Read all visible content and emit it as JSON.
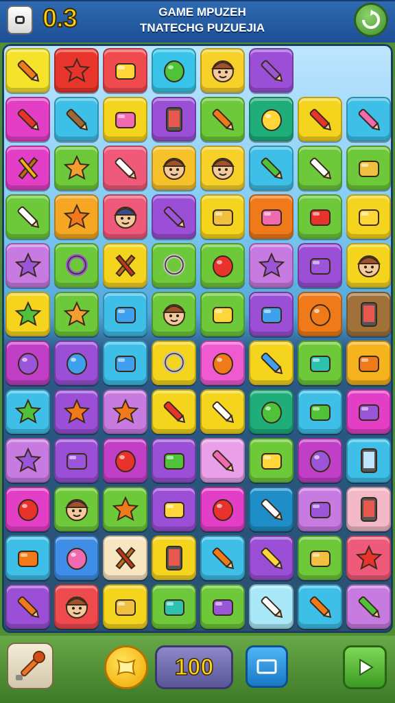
{
  "header": {
    "score": "0.3",
    "title_line1": "GAME MPUZEH",
    "title_line2": "TNATECHG PUZUEJIA"
  },
  "footer": {
    "moves_value": "100"
  },
  "board": {
    "rows": [
      [
        {
          "icon": "orange-crayon",
          "bg": "#f5e22a"
        },
        {
          "icon": "red-candy",
          "bg": "#e8362c"
        },
        {
          "icon": "yellow-sandwich",
          "bg": "#ef4a4e"
        },
        {
          "icon": "green-egg",
          "bg": "#38c4e8"
        },
        {
          "icon": "character-face",
          "bg": "#f7d12a"
        },
        {
          "icon": "purple-pencil",
          "bg": "#9a4fd6"
        },
        {
          "icon": "none",
          "bg": ""
        },
        {
          "icon": "none",
          "bg": ""
        }
      ],
      [
        {
          "icon": "red-marker",
          "bg": "#e23fc6"
        },
        {
          "icon": "brown-spoon",
          "bg": "#3ebfe8"
        },
        {
          "icon": "pink-popsicle",
          "bg": "#f5d41e"
        },
        {
          "icon": "phone",
          "bg": "#9a4fd6"
        },
        {
          "icon": "orange-marker",
          "bg": "#6dc83a"
        },
        {
          "icon": "yellow-lemon",
          "bg": "#1fae7a"
        },
        {
          "icon": "red-marker",
          "bg": "#f5d41e"
        },
        {
          "icon": "pink-marker",
          "bg": "#3ebfe8"
        }
      ],
      [
        {
          "icon": "hammer",
          "bg": "#e23fc6"
        },
        {
          "icon": "cookie",
          "bg": "#6dc83a"
        },
        {
          "icon": "marker",
          "bg": "#ef5a7a"
        },
        {
          "icon": "character-face",
          "bg": "#f7c12a"
        },
        {
          "icon": "character-face",
          "bg": "#f7d12a"
        },
        {
          "icon": "green-lollipop",
          "bg": "#3ebfe8"
        },
        {
          "icon": "pen",
          "bg": "#6dc83a"
        },
        {
          "icon": "ice-cream",
          "bg": "#6dc83a"
        }
      ],
      [
        {
          "icon": "microphone",
          "bg": "#6dc83a"
        },
        {
          "icon": "orange-blob",
          "bg": "#f5a623"
        },
        {
          "icon": "ninja-face",
          "bg": "#ef5a7a"
        },
        {
          "icon": "purple-pencil",
          "bg": "#9a4fd6"
        },
        {
          "icon": "wallet",
          "bg": "#f5d41e"
        },
        {
          "icon": "pink-gem",
          "bg": "#f07a1a"
        },
        {
          "icon": "red-plate",
          "bg": "#6dc83a"
        },
        {
          "icon": "yellow-block",
          "bg": "#f5d41e"
        }
      ],
      [
        {
          "icon": "purple-blob",
          "bg": "#c77ae0"
        },
        {
          "icon": "purple-donut",
          "bg": "#6dc83a"
        },
        {
          "icon": "bow",
          "bg": "#f5d41e"
        },
        {
          "icon": "ring",
          "bg": "#6dc83a"
        },
        {
          "icon": "red-apple",
          "bg": "#6dc83a"
        },
        {
          "icon": "purple-blob",
          "bg": "#c77ae0"
        },
        {
          "icon": "purple-popsicle",
          "bg": "#9a4fd6"
        },
        {
          "icon": "character-face",
          "bg": "#f5d41e"
        }
      ],
      [
        {
          "icon": "green-leaf",
          "bg": "#f5d41e"
        },
        {
          "icon": "banana",
          "bg": "#6dc83a"
        },
        {
          "icon": "blue-box",
          "bg": "#3ebfe8"
        },
        {
          "icon": "mushroom-man",
          "bg": "#6dc83a"
        },
        {
          "icon": "yellow-block",
          "bg": "#6dc83a"
        },
        {
          "icon": "blue-tub",
          "bg": "#9a4fd6"
        },
        {
          "icon": "orange-fruit",
          "bg": "#f07a1a"
        },
        {
          "icon": "phone",
          "bg": "#a0723a"
        }
      ],
      [
        {
          "icon": "purple-balloon",
          "bg": "#c03fc6"
        },
        {
          "icon": "blue-balloon",
          "bg": "#9a4fd6"
        },
        {
          "icon": "blue-eraser",
          "bg": "#3ebfe8"
        },
        {
          "icon": "magnifier",
          "bg": "#f5d41e"
        },
        {
          "icon": "orange-drop",
          "bg": "#ef5ad0"
        },
        {
          "icon": "blue-marker",
          "bg": "#f5d41e"
        },
        {
          "icon": "teal-bottle",
          "bg": "#6dc83a"
        },
        {
          "icon": "orange-cap",
          "bg": "#f5b31e"
        }
      ],
      [
        {
          "icon": "green-blob",
          "bg": "#3ebfe8"
        },
        {
          "icon": "orange-blob",
          "bg": "#9a4fd6"
        },
        {
          "icon": "orange-star",
          "bg": "#c77ae0"
        },
        {
          "icon": "red-brush",
          "bg": "#f5d41e"
        },
        {
          "icon": "brush",
          "bg": "#f5d41e"
        },
        {
          "icon": "green-egg",
          "bg": "#1fae7a"
        },
        {
          "icon": "green-bottle",
          "bg": "#3ebfe8"
        },
        {
          "icon": "purple-eraser",
          "bg": "#e23fc6"
        }
      ],
      [
        {
          "icon": "purple-blob",
          "bg": "#c77ae0"
        },
        {
          "icon": "purple-eraser",
          "bg": "#9a4fd6"
        },
        {
          "icon": "red-ball",
          "bg": "#c03fc6"
        },
        {
          "icon": "green-cup",
          "bg": "#9a4fd6"
        },
        {
          "icon": "pink-marker",
          "bg": "#e9a0e8"
        },
        {
          "icon": "yellow-bottle",
          "bg": "#6dc83a"
        },
        {
          "icon": "purple-balloon",
          "bg": "#c03fc6"
        },
        {
          "icon": "screen",
          "bg": "#3ebfe8"
        }
      ],
      [
        {
          "icon": "red-ball",
          "bg": "#e23fc6"
        },
        {
          "icon": "character-face",
          "bg": "#6dc83a"
        },
        {
          "icon": "orange-star",
          "bg": "#6dc83a"
        },
        {
          "icon": "yellow-bar",
          "bg": "#9a4fd6"
        },
        {
          "icon": "red-apple",
          "bg": "#e23fc6"
        },
        {
          "icon": "pencil",
          "bg": "#1f8ec8"
        },
        {
          "icon": "purple-book",
          "bg": "#c77ae0"
        },
        {
          "icon": "phone",
          "bg": "#f2b8c8"
        }
      ],
      [
        {
          "icon": "orange-bottle",
          "bg": "#3ebfe8"
        },
        {
          "icon": "pink-ball",
          "bg": "#3e8ee8"
        },
        {
          "icon": "red-bow",
          "bg": "#f7e6c0"
        },
        {
          "icon": "phone",
          "bg": "#f5d41e"
        },
        {
          "icon": "orange-pencil",
          "bg": "#3ebfe8"
        },
        {
          "icon": "yellow-marker",
          "bg": "#9a4fd6"
        },
        {
          "icon": "ice-cream",
          "bg": "#6dc83a"
        },
        {
          "icon": "red-star",
          "bg": "#ef5a7a"
        }
      ],
      [
        {
          "icon": "orange-pencil",
          "bg": "#9a4fd6"
        },
        {
          "icon": "monster",
          "bg": "#ef4a4e"
        },
        {
          "icon": "drum",
          "bg": "#f5d41e"
        },
        {
          "icon": "teal-bottle",
          "bg": "#6dc83a"
        },
        {
          "icon": "purple-bottle",
          "bg": "#6dc83a"
        },
        {
          "icon": "brush",
          "bg": "#a8e8f8"
        },
        {
          "icon": "orange-marker",
          "bg": "#3ebfe8"
        },
        {
          "icon": "green-tool",
          "bg": "#c77ae0"
        }
      ]
    ]
  }
}
